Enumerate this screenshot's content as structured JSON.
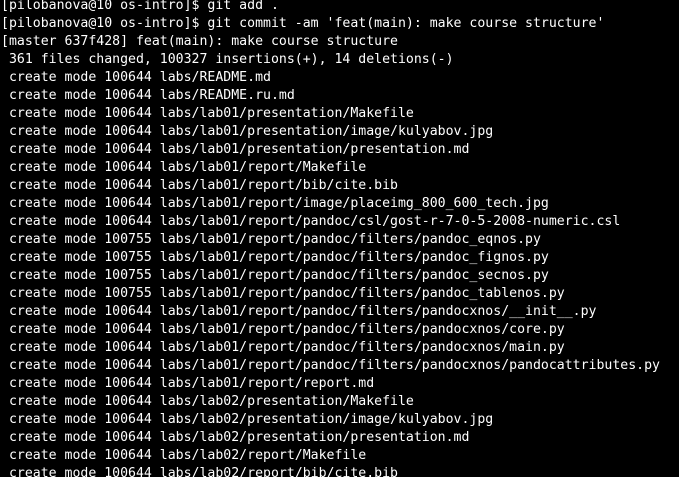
{
  "terminal": {
    "colors": {
      "background": "#000000",
      "foreground": "#ffffff"
    },
    "lines": [
      "[pilobanova@10 os-intro]$ git add .",
      "[pilobanova@10 os-intro]$ git commit -am 'feat(main): make course structure'",
      "[master 637f428] feat(main): make course structure",
      " 361 files changed, 100327 insertions(+), 14 deletions(-)",
      " create mode 100644 labs/README.md",
      " create mode 100644 labs/README.ru.md",
      " create mode 100644 labs/lab01/presentation/Makefile",
      " create mode 100644 labs/lab01/presentation/image/kulyabov.jpg",
      " create mode 100644 labs/lab01/presentation/presentation.md",
      " create mode 100644 labs/lab01/report/Makefile",
      " create mode 100644 labs/lab01/report/bib/cite.bib",
      " create mode 100644 labs/lab01/report/image/placeimg_800_600_tech.jpg",
      " create mode 100644 labs/lab01/report/pandoc/csl/gost-r-7-0-5-2008-numeric.csl",
      " create mode 100755 labs/lab01/report/pandoc/filters/pandoc_eqnos.py",
      " create mode 100755 labs/lab01/report/pandoc/filters/pandoc_fignos.py",
      " create mode 100755 labs/lab01/report/pandoc/filters/pandoc_secnos.py",
      " create mode 100755 labs/lab01/report/pandoc/filters/pandoc_tablenos.py",
      " create mode 100644 labs/lab01/report/pandoc/filters/pandocxnos/__init__.py",
      " create mode 100644 labs/lab01/report/pandoc/filters/pandocxnos/core.py",
      " create mode 100644 labs/lab01/report/pandoc/filters/pandocxnos/main.py",
      " create mode 100644 labs/lab01/report/pandoc/filters/pandocxnos/pandocattributes.py",
      " create mode 100644 labs/lab01/report/report.md",
      " create mode 100644 labs/lab02/presentation/Makefile",
      " create mode 100644 labs/lab02/presentation/image/kulyabov.jpg",
      " create mode 100644 labs/lab02/presentation/presentation.md",
      " create mode 100644 labs/lab02/report/Makefile",
      " create mode 100644 labs/lab02/report/bib/cite.bib"
    ]
  }
}
